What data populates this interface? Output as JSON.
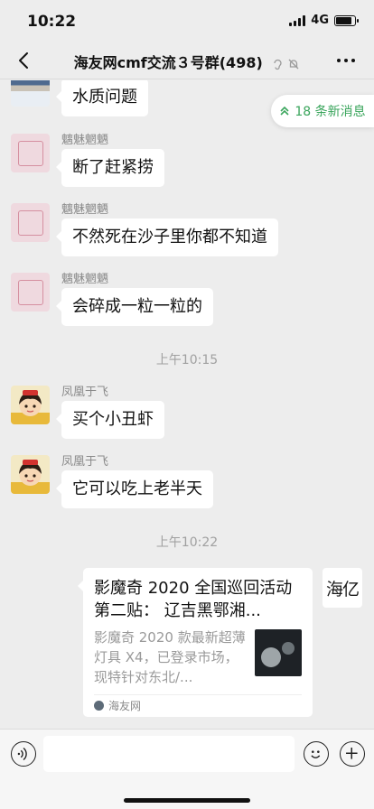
{
  "status_bar": {
    "time": "10:22",
    "network": "4G",
    "battery_level": 0.85
  },
  "nav": {
    "title": "海友网cmf交流３号群(498)",
    "icons": [
      "back-icon",
      "ear-icon",
      "mute-bell-icon",
      "more-icon"
    ]
  },
  "new_messages_pill": {
    "label": "18 条新消息",
    "icon": "double-chevron-up-icon"
  },
  "messages": [
    {
      "sender": "",
      "text": "水质问题",
      "avatar": "landscape-avatar"
    },
    {
      "sender": "魑魅魍魉",
      "text": "断了赶紧捞",
      "avatar": "seal-avatar"
    },
    {
      "sender": "魑魅魍魉",
      "text": "不然死在沙子里你都不知道",
      "avatar": "seal-avatar"
    },
    {
      "sender": "魑魅魍魉",
      "text": "会碎成一粒一粒的",
      "avatar": "seal-avatar"
    },
    {
      "sender": "凤凰于飞",
      "text": "买个小丑虾",
      "avatar": "cartoon-avatar"
    },
    {
      "sender": "凤凰于飞",
      "text": "它可以吃上老半天",
      "avatar": "cartoon-avatar"
    }
  ],
  "timestamps": [
    "上午10:15",
    "上午10:22"
  ],
  "link_card": {
    "title": "影魔奇 2020 全国巡回活动第二贴： 辽吉黑鄂湘...",
    "description": "影魔奇 2020 款最新超薄灯具 X4，已登录市场，现特针对东北/...",
    "source": "海友网",
    "avatar_text": "海亿"
  },
  "input_bar": {
    "placeholder": "",
    "icons": [
      "voice-icon",
      "emoji-icon",
      "plus-icon"
    ]
  }
}
